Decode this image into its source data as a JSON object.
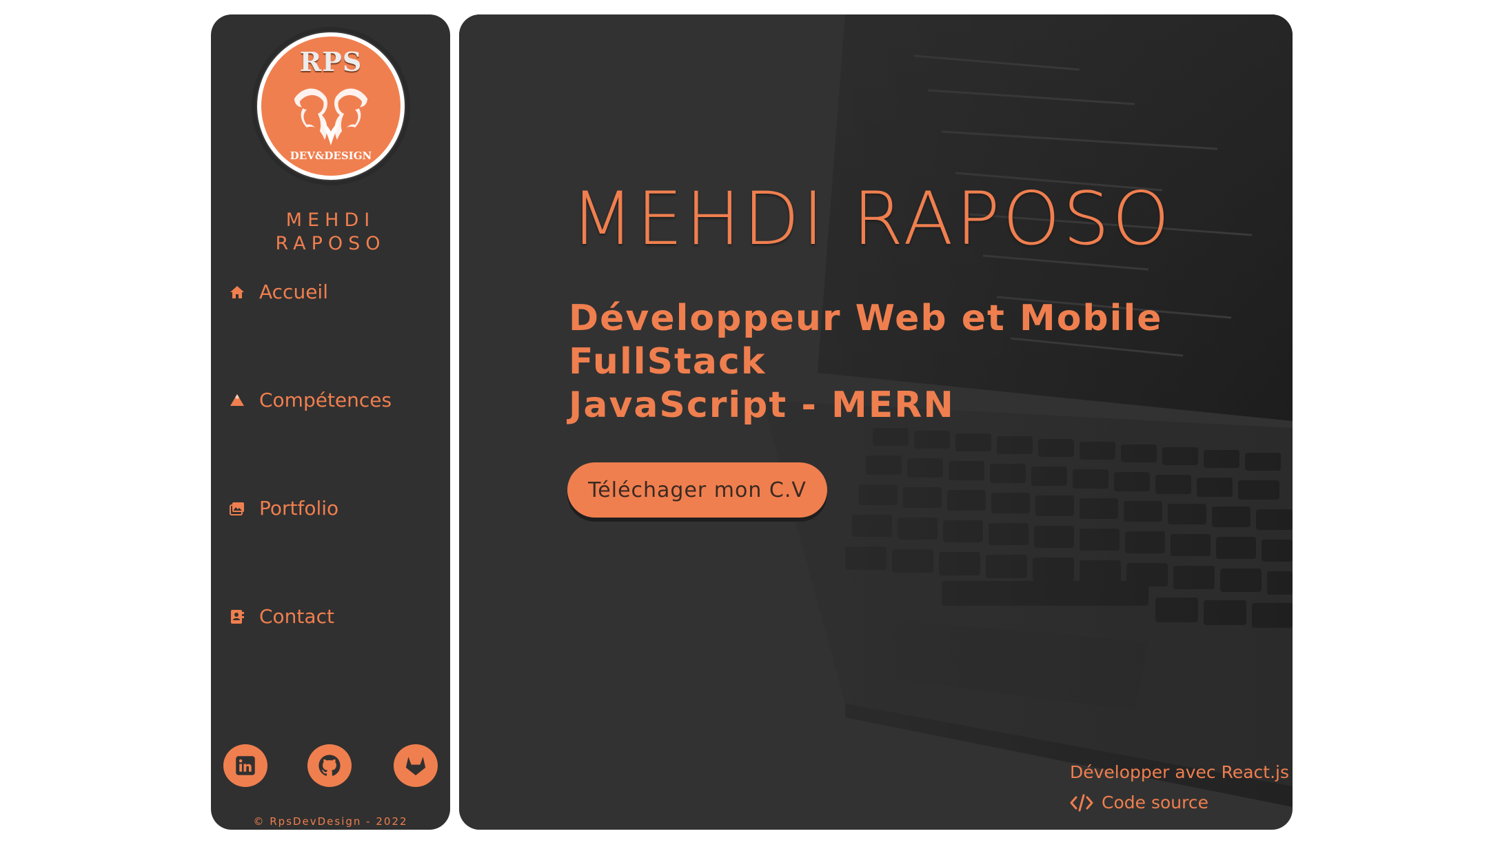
{
  "brand": {
    "logo_text": "RPS",
    "logo_subtext": "DEV&DESIGN",
    "name_line1": "MEHDI",
    "name_line2": "RAPOSO"
  },
  "nav": {
    "items": [
      {
        "label": "Accueil",
        "icon": "home-icon"
      },
      {
        "label": "Compétences",
        "icon": "mountain-icon"
      },
      {
        "label": "Portfolio",
        "icon": "images-icon"
      },
      {
        "label": "Contact",
        "icon": "address-book-icon"
      }
    ]
  },
  "social": {
    "items": [
      {
        "icon": "linkedin-icon"
      },
      {
        "icon": "github-icon"
      },
      {
        "icon": "gitlab-icon"
      }
    ]
  },
  "copyright": "© RpsDevDesign - 2022",
  "hero": {
    "title": "MEHDI RAPOSO",
    "subtitle_line1": "Développeur Web et Mobile FullStack",
    "subtitle_line2": "JavaScript - MERN",
    "cv_button": "Téléchager mon C.V"
  },
  "footer": {
    "built_with": "Développer avec React.js",
    "source_label": "Code source",
    "source_icon": "code-icon"
  },
  "colors": {
    "accent": "#f07f4f",
    "panel": "#303030",
    "background": "#ffffff"
  }
}
